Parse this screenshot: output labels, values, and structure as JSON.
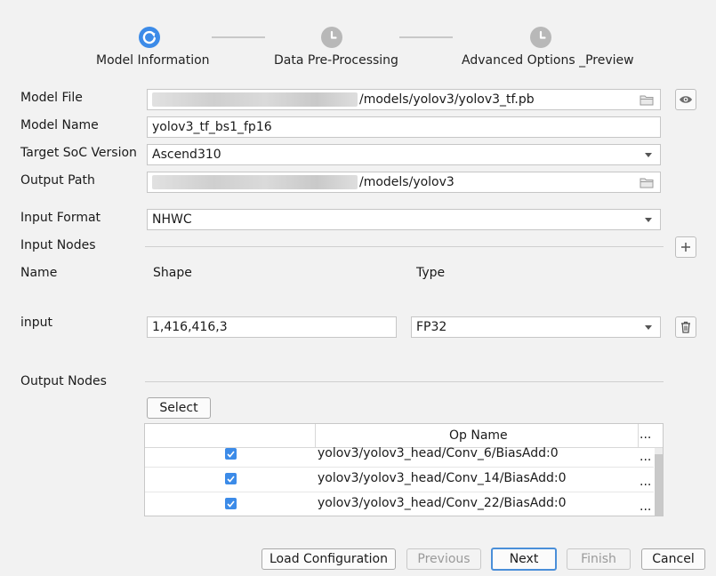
{
  "wizard": {
    "steps": [
      {
        "label": "Model Information",
        "state": "active",
        "icon": "refresh-icon"
      },
      {
        "label": "Data Pre-Processing",
        "state": "pending",
        "icon": "clock-icon"
      },
      {
        "label": "Advanced Options _Preview",
        "state": "pending",
        "icon": "clock-icon"
      }
    ]
  },
  "form": {
    "model_file": {
      "label": "Model File",
      "value": "/models/yolov3/yolov3_tf.pb"
    },
    "model_name": {
      "label": "Model Name",
      "value": "yolov3_tf_bs1_fp16"
    },
    "target_soc": {
      "label": "Target SoC Version",
      "value": "Ascend310"
    },
    "output_path": {
      "label": "Output Path",
      "value": "/models/yolov3"
    },
    "input_format": {
      "label": "Input Format",
      "value": "NHWC"
    }
  },
  "input_nodes": {
    "title": "Input Nodes",
    "col_name": "Name",
    "col_shape": "Shape",
    "col_type": "Type",
    "rows": [
      {
        "name": "input",
        "shape": "1,416,416,3",
        "type": "FP32"
      }
    ]
  },
  "output_nodes": {
    "title": "Output Nodes",
    "select_label": "Select",
    "table": {
      "header": "Op Name",
      "more": "...",
      "rows": [
        {
          "checked": true,
          "op_name": "yolov3/yolov3_head/Conv_6/BiasAdd:0",
          "more": "..."
        },
        {
          "checked": true,
          "op_name": "yolov3/yolov3_head/Conv_14/BiasAdd:0",
          "more": "..."
        },
        {
          "checked": true,
          "op_name": "yolov3/yolov3_head/Conv_22/BiasAdd:0",
          "more": "..."
        }
      ]
    }
  },
  "footer": {
    "load_config": "Load Configuration",
    "previous": "Previous",
    "next": "Next",
    "finish": "Finish",
    "cancel": "Cancel"
  },
  "colors": {
    "accent": "#3c8be8",
    "pending": "#b8b8b8"
  }
}
